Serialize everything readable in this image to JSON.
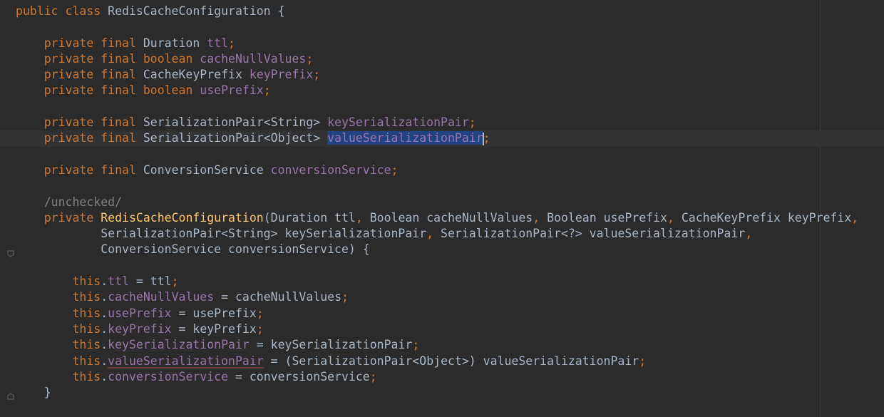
{
  "editor": {
    "lines": [
      [
        [
          "kw",
          "public class "
        ],
        [
          "ty",
          "RedisCacheConfiguration "
        ],
        [
          "plain",
          "{"
        ]
      ],
      [],
      [
        [
          "plain",
          "    "
        ],
        [
          "kw",
          "private final "
        ],
        [
          "ty",
          "Duration "
        ],
        [
          "field",
          "ttl"
        ],
        [
          "kw",
          ";"
        ]
      ],
      [
        [
          "plain",
          "    "
        ],
        [
          "kw",
          "private final boolean "
        ],
        [
          "field",
          "cacheNullValues"
        ],
        [
          "kw",
          ";"
        ]
      ],
      [
        [
          "plain",
          "    "
        ],
        [
          "kw",
          "private final "
        ],
        [
          "ty",
          "CacheKeyPrefix "
        ],
        [
          "field",
          "keyPrefix"
        ],
        [
          "kw",
          ";"
        ]
      ],
      [
        [
          "plain",
          "    "
        ],
        [
          "kw",
          "private final boolean "
        ],
        [
          "field",
          "usePrefix"
        ],
        [
          "kw",
          ";"
        ]
      ],
      [],
      [
        [
          "plain",
          "    "
        ],
        [
          "kw",
          "private final "
        ],
        [
          "ty",
          "SerializationPair<String> "
        ],
        [
          "field",
          "keySerializationPair"
        ],
        [
          "kw",
          ";"
        ]
      ],
      [
        [
          "plain",
          "    "
        ],
        [
          "kw",
          "private final "
        ],
        [
          "ty",
          "SerializationPair<Object> "
        ],
        [
          "sel",
          "valueSerializationPair"
        ],
        [
          "caret",
          ""
        ],
        [
          "kw",
          ";"
        ]
      ],
      [],
      [
        [
          "plain",
          "    "
        ],
        [
          "kw",
          "private final "
        ],
        [
          "ty",
          "ConversionService "
        ],
        [
          "field",
          "conversionService"
        ],
        [
          "kw",
          ";"
        ]
      ],
      [],
      [
        [
          "plain",
          "    "
        ],
        [
          "comment",
          "/unchecked/"
        ]
      ],
      [
        [
          "plain",
          "    "
        ],
        [
          "kw",
          "private "
        ],
        [
          "fn",
          "RedisCacheConfiguration"
        ],
        [
          "plain",
          "(Duration ttl"
        ],
        [
          "kw",
          ", "
        ],
        [
          "plain",
          "Boolean cacheNullValues"
        ],
        [
          "kw",
          ", "
        ],
        [
          "plain",
          "Boolean usePrefix"
        ],
        [
          "kw",
          ", "
        ],
        [
          "plain",
          "CacheKeyPrefix keyPrefix"
        ],
        [
          "kw",
          ","
        ]
      ],
      [
        [
          "plain",
          "            SerializationPair<String> keySerializationPair"
        ],
        [
          "kw",
          ", "
        ],
        [
          "plain",
          "SerializationPair<?> valueSerializationPair"
        ],
        [
          "kw",
          ","
        ]
      ],
      [
        [
          "plain",
          "            ConversionService conversionService) {"
        ]
      ],
      [],
      [
        [
          "plain",
          "        "
        ],
        [
          "kw",
          "this"
        ],
        [
          "plain",
          "."
        ],
        [
          "field",
          "ttl"
        ],
        [
          "plain",
          " = ttl"
        ],
        [
          "kw",
          ";"
        ]
      ],
      [
        [
          "plain",
          "        "
        ],
        [
          "kw",
          "this"
        ],
        [
          "plain",
          "."
        ],
        [
          "field",
          "cacheNullValues"
        ],
        [
          "plain",
          " = cacheNullValues"
        ],
        [
          "kw",
          ";"
        ]
      ],
      [
        [
          "plain",
          "        "
        ],
        [
          "kw",
          "this"
        ],
        [
          "plain",
          "."
        ],
        [
          "field",
          "usePrefix"
        ],
        [
          "plain",
          " = usePrefix"
        ],
        [
          "kw",
          ";"
        ]
      ],
      [
        [
          "plain",
          "        "
        ],
        [
          "kw",
          "this"
        ],
        [
          "plain",
          "."
        ],
        [
          "field",
          "keyPrefix"
        ],
        [
          "plain",
          " = keyPrefix"
        ],
        [
          "kw",
          ";"
        ]
      ],
      [
        [
          "plain",
          "        "
        ],
        [
          "kw",
          "this"
        ],
        [
          "plain",
          "."
        ],
        [
          "field",
          "keySerializationPair"
        ],
        [
          "plain",
          " = keySerializationPair"
        ],
        [
          "kw",
          ";"
        ]
      ],
      [
        [
          "plain",
          "        "
        ],
        [
          "kw",
          "this"
        ],
        [
          "plain",
          "."
        ],
        [
          "fieldwarn",
          "valueSerializationPair"
        ],
        [
          "plain",
          " = (SerializationPair<Object>) valueSerializationPair"
        ],
        [
          "kw",
          ";"
        ]
      ],
      [
        [
          "plain",
          "        "
        ],
        [
          "kw",
          "this"
        ],
        [
          "plain",
          "."
        ],
        [
          "field",
          "conversionService"
        ],
        [
          "plain",
          " = conversionService"
        ],
        [
          "kw",
          ";"
        ]
      ],
      [
        [
          "plain",
          "    }"
        ]
      ]
    ],
    "current_line": 8,
    "colors": {
      "background": "#2b2b2b",
      "keyword": "#cc7832",
      "field": "#9876aa",
      "method": "#ffc66d",
      "text": "#a9b7c6",
      "comment": "#808080",
      "selection": "#214283"
    },
    "icons": {
      "intention": "lightbulb-icon",
      "fold": "fold-marker-icon"
    }
  }
}
